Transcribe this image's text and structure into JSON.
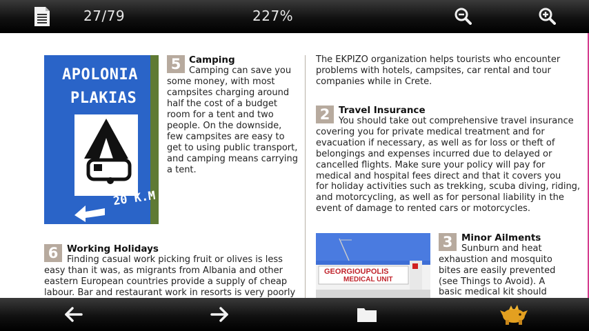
{
  "toolbar": {
    "page_indicator": "27/79",
    "zoom_level": "227%",
    "icons": [
      "document-list-icon",
      "zoom-out-icon",
      "zoom-in-icon"
    ]
  },
  "bottombar": {
    "icons": [
      "back-arrow-icon",
      "forward-arrow-icon",
      "folder-icon",
      "mascot-icon"
    ]
  },
  "colors": {
    "bar": "#111111",
    "number_box": "#b7aa9e",
    "sign_blue": "#2a64c8",
    "page_edge": "#d43b8e"
  },
  "left_column": {
    "photo_sign": {
      "line1": "APOLONIA",
      "line2": "PLAKIAS",
      "distance": "20 K.M"
    },
    "camping": {
      "number": "5",
      "title": "Camping",
      "lines": [
        "Camping can save you",
        "some money, with most",
        "campsites charging around",
        "half the cost of a budget",
        "room for a tent and two",
        "people. On the downside,",
        "few campsites are easy to",
        "get to using public transport,",
        "and camping means carrying",
        "a tent."
      ]
    },
    "working": {
      "number": "6",
      "title": "Working Holidays",
      "lines": [
        "Finding casual work picking fruit or olives is less",
        "easy than it was, as migrants from Albania and other",
        "eastern European countries provide a supply of cheap",
        "labour. Bar and restaurant work in resorts is very poorly"
      ]
    }
  },
  "right_column": {
    "intro_lines": [
      "The EKPIZO organization helps tourists who encounter",
      "problems with hotels, campsites, car rental and tour",
      "companies while in Crete."
    ],
    "travel": {
      "number": "2",
      "title": "Travel Insurance",
      "lines": [
        "You should take out comprehensive travel insurance",
        "covering you for private medical treatment and for",
        "evacuation if necessary, as well as for loss or theft of",
        "belongings and expenses incurred due to delayed or",
        "cancelled flights. Make sure your policy will pay for",
        "medical and hospital fees direct and that it covers you",
        "for holiday activities such as trekking, scuba diving, riding,",
        "and motorcycling, as well as for personal liability in the",
        "event of damage to rented cars or motorcycles."
      ]
    },
    "photo_medical": {
      "line1": "GEORGIOUPOLIS",
      "line2": "MEDICAL UNIT"
    },
    "ailments": {
      "number": "3",
      "title": "Minor Ailments",
      "lines": [
        "Sunburn and heat",
        "exhaustion and mosquito",
        "bites are easily prevented",
        "(see Things to Avoid). A",
        "basic medical kit should"
      ]
    }
  }
}
